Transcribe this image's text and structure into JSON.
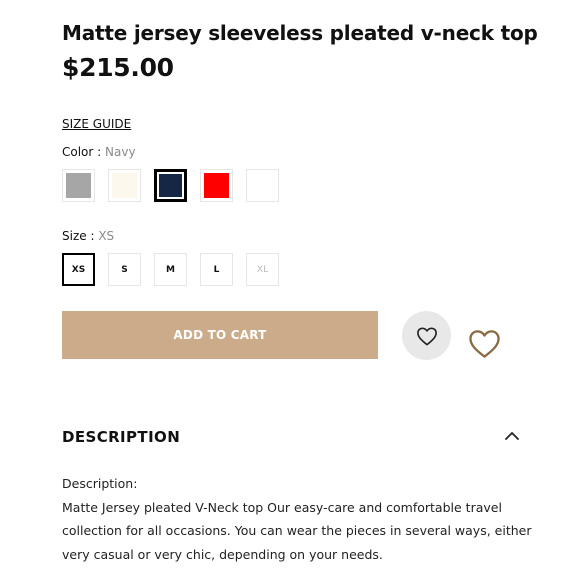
{
  "product": {
    "title": "Matte jersey sleeveless pleated v-neck top",
    "price": "$215.00"
  },
  "size_guide": "SIZE GUIDE",
  "color": {
    "label": "Color :",
    "selected": "Navy",
    "swatches": [
      {
        "name": "Gray",
        "hex": "#a6a6a6",
        "active": false
      },
      {
        "name": "Cream",
        "hex": "#fdf8ee",
        "active": false
      },
      {
        "name": "Navy",
        "hex": "#152744",
        "active": true
      },
      {
        "name": "Red",
        "hex": "#ff0000",
        "active": false
      },
      {
        "name": "White",
        "hex": "#ffffff",
        "active": false
      }
    ]
  },
  "size": {
    "label": "Size :",
    "selected": "XS",
    "options": [
      {
        "label": "XS",
        "state": "active"
      },
      {
        "label": "S",
        "state": "normal"
      },
      {
        "label": "M",
        "state": "normal"
      },
      {
        "label": "L",
        "state": "normal"
      },
      {
        "label": "XL",
        "state": "disabled"
      }
    ]
  },
  "actions": {
    "add_to_cart": "ADD TO CART",
    "button_color": "#cbab89",
    "wishlist_icon": "heart-icon",
    "heart_outline_color": "#8a6a42"
  },
  "description": {
    "heading": "DESCRIPTION",
    "chevron_icon": "chevron-up-icon",
    "lead": "Description:",
    "text": "Matte Jersey pleated V-Neck top Our easy-care and comfortable travel collection for all occasions. You can wear the pieces in several ways, either very casual or very chic, depending on your needs."
  }
}
